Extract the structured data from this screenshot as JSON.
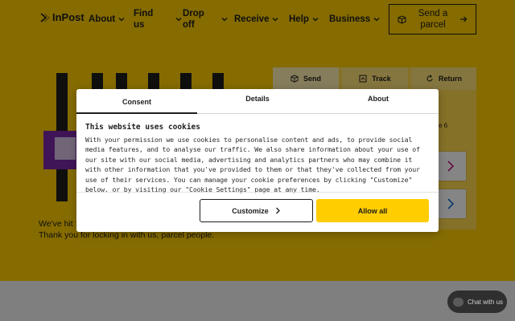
{
  "brand": {
    "logo_text": "InPost",
    "accent": "#ffcd00"
  },
  "nav": {
    "items": [
      {
        "label": "About"
      },
      {
        "label": "Find us"
      },
      {
        "label": "Drop off"
      },
      {
        "label": "Receive"
      },
      {
        "label": "Help"
      },
      {
        "label": "Business"
      }
    ],
    "cta_label": "Send a parcel"
  },
  "hero": {
    "text": "We've hit 1 Locker life is becoming the new normal. Thank you for locking in with us, parcel people."
  },
  "services": {
    "tabs": [
      {
        "label": "Send",
        "icon": "box-icon"
      },
      {
        "label": "Track",
        "icon": "track-icon"
      },
      {
        "label": "Return",
        "icon": "return-icon"
      }
    ],
    "peek_text": "e 6"
  },
  "chat": {
    "label": "Chat with us"
  },
  "consent": {
    "tabs": [
      {
        "label": "Consent"
      },
      {
        "label": "Details"
      },
      {
        "label": "About"
      }
    ],
    "title": "This website uses cookies",
    "body": "With your permission we use cookies to personalise content and ads, to provide social media features, and to analyse our traffic. We also share information about your use of our site with our social media, advertising and analytics partners who may combine it with other information that you've provided to them or that they've collected from your use of their services. You can manage your cookie preferences by clicking \"Customize\" below, or by visiting our \"Cookie Settings\" page at any time.",
    "customize_label": "Customize",
    "allow_label": "Allow all"
  }
}
